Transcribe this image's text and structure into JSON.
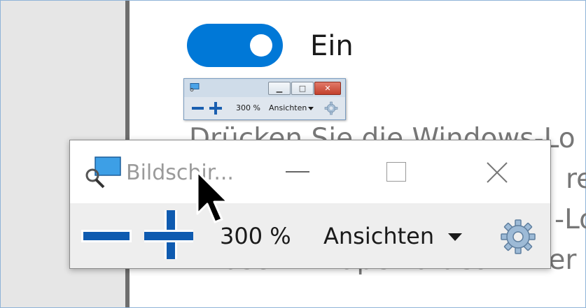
{
  "toggle": {
    "state_label": "Ein",
    "on": true,
    "accent": "#0078d7"
  },
  "body_text": [
    "Drücken Sie die Windows-Lo",
    "ren",
    "-Lo",
    "Bildschirmlupe zu deaktivier"
  ],
  "small_magnifier": {
    "app_icon": "magnifier-app-icon",
    "minimize_icon": "minimize-icon",
    "maximize_icon": "maximize-icon",
    "close_icon": "close-icon",
    "zoom_out_icon": "minus-icon",
    "zoom_in_icon": "plus-icon",
    "zoom_level": "300 %",
    "views_label": "Ansichten",
    "settings_icon": "gear-icon"
  },
  "large_magnifier": {
    "app_icon": "magnifier-app-icon",
    "title": "Bildschir...",
    "zoom_level": "300 %",
    "views_label": "Ansichten",
    "zoom_out_icon": "minus-icon",
    "zoom_in_icon": "plus-icon",
    "settings_icon": "gear-icon",
    "accent": "#0f5bb0"
  },
  "cursor": "arrow-cursor-icon"
}
